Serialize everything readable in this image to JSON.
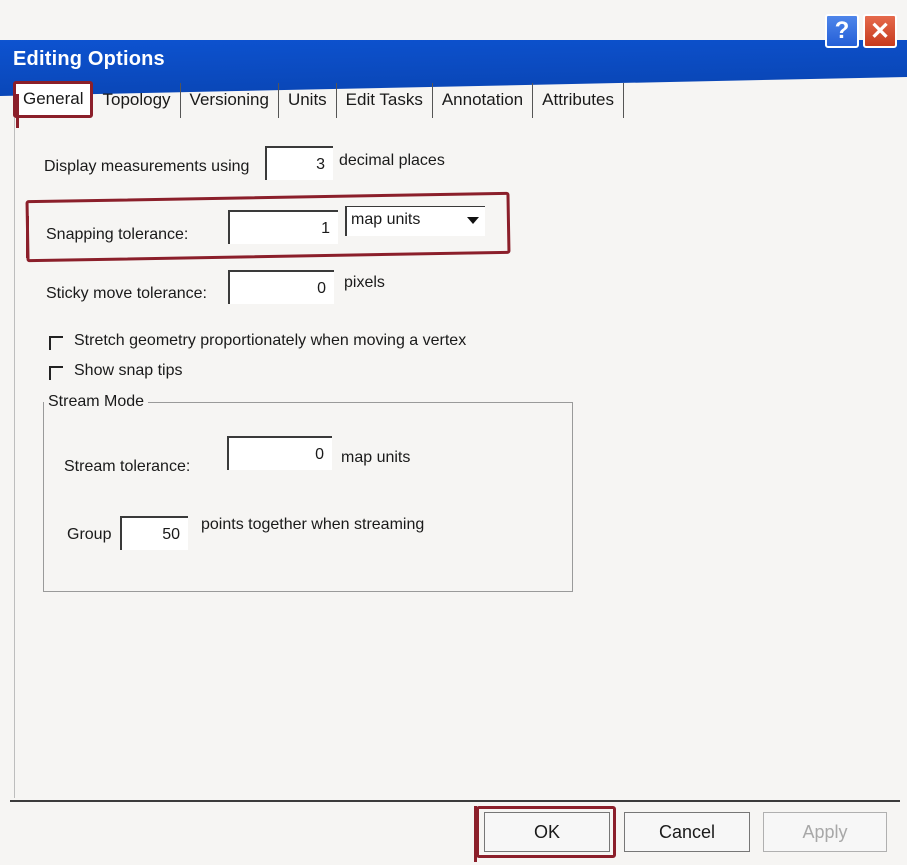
{
  "window": {
    "title": "Editing Options",
    "help_glyph": "?",
    "close_glyph": "✕"
  },
  "tabs": [
    {
      "label": "General",
      "active": true
    },
    {
      "label": "Topology",
      "active": false
    },
    {
      "label": "Versioning",
      "active": false
    },
    {
      "label": "Units",
      "active": false
    },
    {
      "label": "Edit Tasks",
      "active": false
    },
    {
      "label": "Annotation",
      "active": false
    },
    {
      "label": "Attributes",
      "active": false
    }
  ],
  "general": {
    "display_measurements_prefix": "Display measurements using",
    "display_measurements_value": "3",
    "display_measurements_suffix": "decimal places",
    "snapping_label": "Snapping tolerance:",
    "snapping_value": "1",
    "snapping_units": "map units",
    "sticky_label": "Sticky move tolerance:",
    "sticky_value": "0",
    "sticky_suffix": "pixels",
    "stretch_label": "Stretch geometry proportionately when moving a vertex",
    "stretch_checked": false,
    "snap_tips_label": "Show snap tips",
    "snap_tips_checked": false
  },
  "stream_mode": {
    "legend": "Stream Mode",
    "tolerance_label": "Stream tolerance:",
    "tolerance_value": "0",
    "tolerance_suffix": "map units",
    "group_prefix": "Group",
    "group_value": "50",
    "group_suffix": "points together when streaming"
  },
  "buttons": {
    "ok": "OK",
    "cancel": "Cancel",
    "apply": "Apply"
  },
  "colors": {
    "titlebar": "#0d52cf",
    "highlight": "#8b1f2a"
  }
}
